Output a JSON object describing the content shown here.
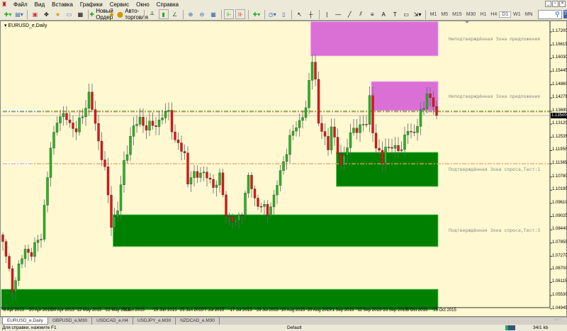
{
  "menu": [
    "Файл",
    "Вид",
    "Вставка",
    "Графики",
    "Сервис",
    "Окно",
    "Справка"
  ],
  "toolbar": {
    "new_order": "Новый Ордер",
    "auto_trading": "Авто-торговля",
    "timeframes": [
      "M1",
      "M5",
      "M15",
      "M30",
      "H1",
      "H4",
      "D1",
      "W1",
      "MN"
    ],
    "active_timeframe": "D1",
    "search_placeholder": ""
  },
  "chart": {
    "title": "EURUSD_e,Daily",
    "current_price": "1.13500",
    "price_labels": [
      "1.17200",
      "1.16615",
      "1.16030",
      "1.15445",
      "1.14860",
      "1.14275",
      "1.13690",
      "1.13120",
      "1.12535",
      "1.11950",
      "1.11365",
      "1.10780",
      "1.10195",
      "1.09610",
      "1.09025",
      "1.08440",
      "1.07855",
      "1.07270",
      "1.06700",
      "1.06115",
      "1.05530",
      "1.04945"
    ],
    "date_labels": [
      [
        "8 Apr 2015",
        0
      ],
      [
        "20 Apr 2015",
        8
      ],
      [
        "30 Apr 2015",
        15
      ],
      [
        "12 May 2015",
        23
      ],
      [
        "22 May 2015",
        32
      ],
      [
        "3 Jun 2015",
        37.6
      ],
      [
        "15 Jun 2015",
        47
      ],
      [
        "25 Jun 2015",
        55.3
      ],
      [
        "7 Jul 2015",
        63
      ],
      [
        "17 Jul 2015",
        71
      ],
      [
        "29 Jul 2015",
        79.3
      ],
      [
        "10 Aug 2015",
        87
      ],
      [
        "20 Aug 2015",
        95.3
      ],
      [
        "1 Sep 2015",
        103
      ],
      [
        "11 Sep 2015",
        111
      ],
      [
        "23 Sep 2015",
        119
      ],
      [
        "5 Oct 2015",
        126.4
      ],
      [
        "15 Oct 2015",
        134.7
      ]
    ],
    "zones": [
      {
        "label": "Неподтверждённая Зона предложения",
        "type": "supply",
        "from_bar": 97,
        "top": 1.1765,
        "bottom": 1.1614,
        "color": "#da70d6"
      },
      {
        "label": "Неподтверждённая Зона предложения",
        "type": "supply",
        "from_bar": 116,
        "top": 1.15,
        "bottom": 1.1372,
        "color": "#da70d6"
      },
      {
        "label": "Подтверждённая Зона спроса,Тест:1",
        "type": "demand",
        "from_bar": 105,
        "top": 1.1187,
        "bottom": 1.1036,
        "color": "#008000"
      },
      {
        "label": "Подтверждённая Зона спроса,Тест:3",
        "type": "demand",
        "from_bar": 35,
        "top": 1.0911,
        "bottom": 1.077,
        "color": "#008000"
      },
      {
        "label": "",
        "type": "demand",
        "from_bar": 0,
        "top": 1.0581,
        "bottom": 1.049,
        "color": "#008000"
      }
    ],
    "levels": [
      {
        "price": 1.1369,
        "color": "#44aa44"
      },
      {
        "price": 1.1366,
        "color": "#ff9966"
      },
      {
        "price": 1.11365,
        "color": "#ff9966"
      }
    ],
    "colors": {
      "bg": "#fff8d0",
      "bull": "#22bb22",
      "bear": "#ee1111"
    }
  },
  "chart_data": {
    "type": "candlestick",
    "symbol": "EURUSD_e",
    "timeframe": "Daily",
    "bars": 137,
    "ylim": [
      1.0469,
      1.1765
    ],
    "close_path": [
      [
        0,
        1.0792
      ],
      [
        3,
        1.0588
      ],
      [
        7,
        1.076
      ],
      [
        9,
        1.0738
      ],
      [
        12,
        1.0823
      ],
      [
        15,
        1.1199
      ],
      [
        17,
        1.134
      ],
      [
        20,
        1.134
      ],
      [
        23,
        1.1278
      ],
      [
        25,
        1.1356
      ],
      [
        27,
        1.1441
      ],
      [
        29,
        1.1309
      ],
      [
        32,
        1.1105
      ],
      [
        34,
        1.087
      ],
      [
        36,
        1.0933
      ],
      [
        38,
        1.1137
      ],
      [
        40,
        1.1262
      ],
      [
        43,
        1.134
      ],
      [
        45,
        1.1293
      ],
      [
        49,
        1.1325
      ],
      [
        52,
        1.1372
      ],
      [
        54,
        1.1231
      ],
      [
        57,
        1.1184
      ],
      [
        58,
        1.1058
      ],
      [
        62,
        1.1105
      ],
      [
        66,
        1.1042
      ],
      [
        68,
        1.1074
      ],
      [
        70,
        1.0917
      ],
      [
        73,
        1.087
      ],
      [
        75,
        1.0933
      ],
      [
        77,
        1.1074
      ],
      [
        79,
        1.098
      ],
      [
        83,
        1.0917
      ],
      [
        85,
        1.0995
      ],
      [
        87,
        1.109
      ],
      [
        88,
        1.1152
      ],
      [
        90,
        1.1246
      ],
      [
        94,
        1.1356
      ],
      [
        95,
        1.1372
      ],
      [
        97,
        1.1607
      ],
      [
        98,
        1.1513
      ],
      [
        99,
        1.1309
      ],
      [
        102,
        1.1215
      ],
      [
        103,
        1.1309
      ],
      [
        104,
        1.1231
      ],
      [
        106,
        1.1137
      ],
      [
        108,
        1.1215
      ],
      [
        110,
        1.1293
      ],
      [
        114,
        1.1309
      ],
      [
        115,
        1.1435
      ],
      [
        116,
        1.1293
      ],
      [
        117,
        1.1199
      ],
      [
        119,
        1.1152
      ],
      [
        120,
        1.1215
      ],
      [
        123,
        1.1199
      ],
      [
        125,
        1.1215
      ],
      [
        127,
        1.1278
      ],
      [
        129,
        1.1278
      ],
      [
        131,
        1.1356
      ],
      [
        132,
        1.1372
      ],
      [
        133,
        1.1466
      ],
      [
        135,
        1.1388
      ],
      [
        136,
        1.135
      ]
    ]
  },
  "tabs": [
    "EURUSD_e,Daily",
    "GBPUSD_e,M30",
    "USDCAD_e,H4",
    "USDJPY_e,M30",
    "NZDCAD_e,M30"
  ],
  "status": {
    "help": "Для справки, нажмите F1",
    "profile": "Default",
    "traffic": "34/1 kb"
  }
}
